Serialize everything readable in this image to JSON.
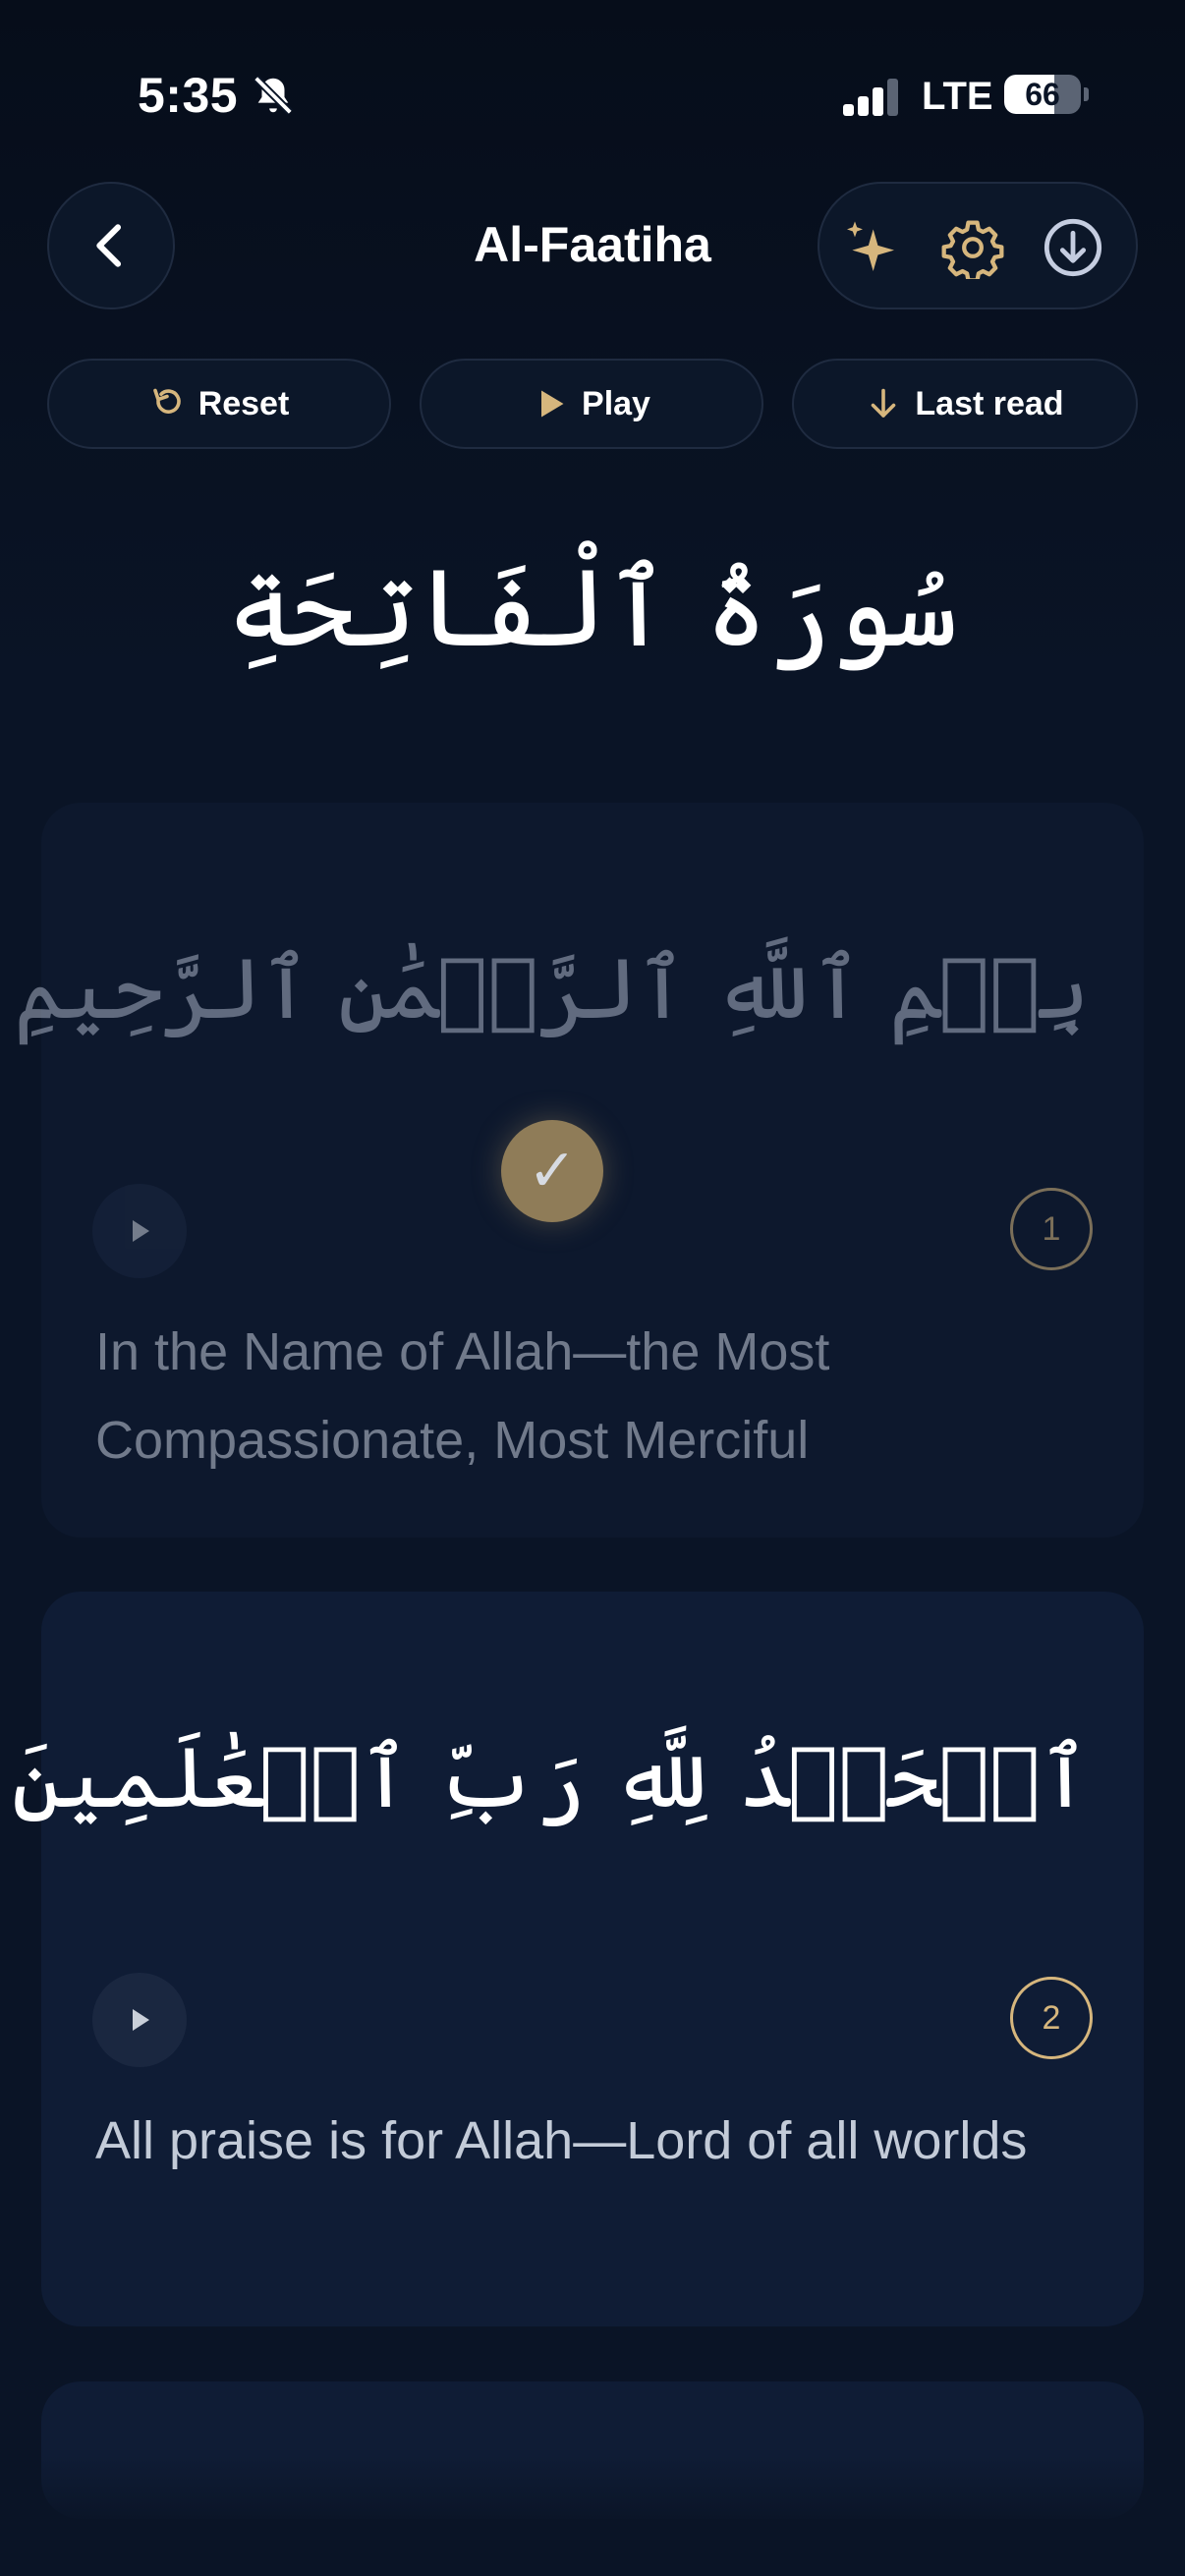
{
  "status_bar": {
    "time": "5:35",
    "network": "LTE",
    "battery": "66",
    "battery_level": 0.66,
    "signal_bars": 3
  },
  "header": {
    "title": "Al-Faatiha"
  },
  "icons": {
    "back": "chevron-left-icon",
    "ai": "sparkles-icon",
    "settings": "gear-icon",
    "download": "download-circle-icon",
    "silent": "bell-slash-icon"
  },
  "actions": {
    "reset": "Reset",
    "play": "Play",
    "last_read": "Last read"
  },
  "surah": {
    "arabic_title": "سُورَةُ ٱلْفَاتِحَةِ"
  },
  "ayahs": [
    {
      "number": "1",
      "arabic": "بِسۡمِ ٱللَّهِ ٱلرَّحۡمَٰنِ ٱلرَّحِيمِ",
      "translation": "In the Name of Allah—the Most Compassionate, Most Merciful",
      "read": true
    },
    {
      "number": "2",
      "arabic": "ٱلۡحَمۡدُ لِلَّهِ رَبِّ ٱلۡعَٰلَمِينَ",
      "translation": "All praise is for Allah—Lord of all worlds",
      "read": false
    }
  ],
  "colors": {
    "accent_gold": "#d6b67d",
    "background": "#0a1426",
    "card": "#0f1c35"
  }
}
